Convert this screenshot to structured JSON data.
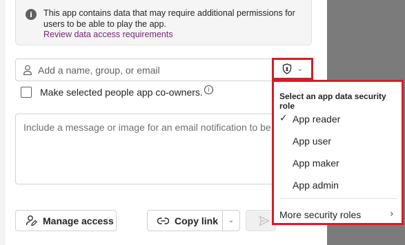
{
  "banner": {
    "text": "This app contains data that may require additional permissions for users to be able to play the app.",
    "link": "Review data access requirements",
    "icon": "info-icon"
  },
  "people": {
    "placeholder": "Add a name, group, or email",
    "icon": "person-icon",
    "role_icon": "shield-icon"
  },
  "coowners": {
    "label": "Make selected people app co-owners.",
    "checked": false
  },
  "message": {
    "placeholder": "Include a message or image for an email notification to be"
  },
  "buttons": {
    "manage_access": "Manage access",
    "copy_link": "Copy link"
  },
  "role_menu": {
    "title": "Select an app data security role",
    "items": [
      {
        "label": "App reader",
        "selected": true
      },
      {
        "label": "App user",
        "selected": false
      },
      {
        "label": "App maker",
        "selected": false
      },
      {
        "label": "App admin",
        "selected": false
      }
    ],
    "more": "More security roles"
  },
  "colors": {
    "highlight": "#d51c2a",
    "link": "#742774"
  }
}
